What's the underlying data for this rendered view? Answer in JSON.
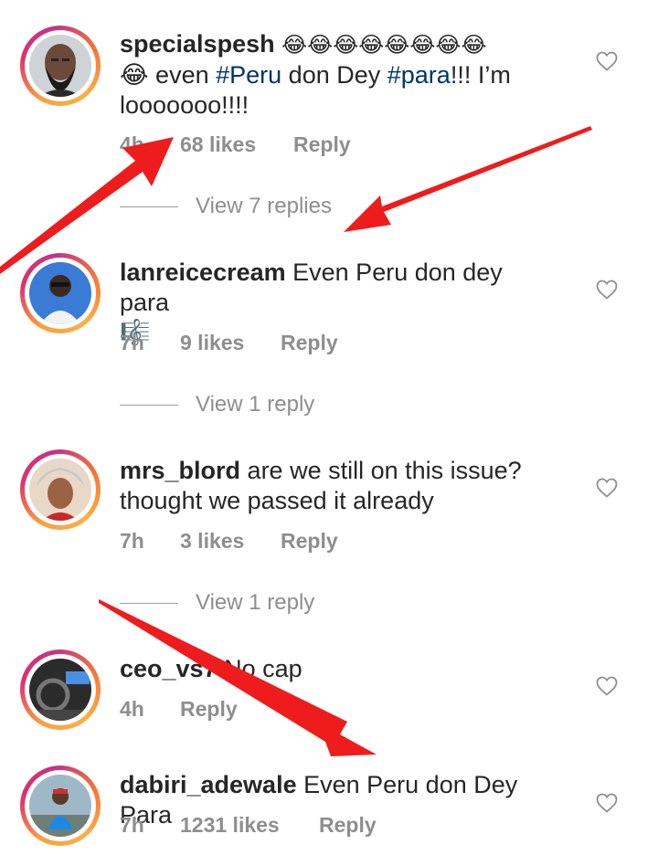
{
  "comments": [
    {
      "username": "specialspesh",
      "emoji_line": "😂😂😂😂😂😂😂😂",
      "text_pre": "😂 even ",
      "tag1": "#Peru",
      "text_mid": " don Dey ",
      "tag2": "#para",
      "text_post": "!!! I’m looooooo!!!!",
      "time": "4h",
      "likes": "68 likes",
      "reply": "Reply",
      "view_replies": "View 7 replies"
    },
    {
      "username": "lanreicecream",
      "text": " Even Peru don dey para",
      "emoji": "🎼",
      "time": "7h",
      "likes": "9 likes",
      "reply": "Reply",
      "view_replies": "View 1 reply"
    },
    {
      "username": "mrs_blord",
      "text": " are we still on this issue? thought we passed it already",
      "time": "7h",
      "likes": "3 likes",
      "reply": "Reply",
      "view_replies": "View 1 reply"
    },
    {
      "username": "ceo_vs7",
      "text": " No cap",
      "time": "4h",
      "reply": "Reply"
    },
    {
      "username": "dabiri_adewale",
      "text": " Even Peru don Dey Para",
      "time": "7h",
      "likes": "1231 likes",
      "reply": "Reply"
    }
  ],
  "icons": {
    "like": "heart-outline-icon",
    "annotation": "red-arrow"
  },
  "colors": {
    "accent_arrow": "#ee1c1c",
    "meta_text": "#8e8e8e",
    "hashtag": "#003569"
  }
}
